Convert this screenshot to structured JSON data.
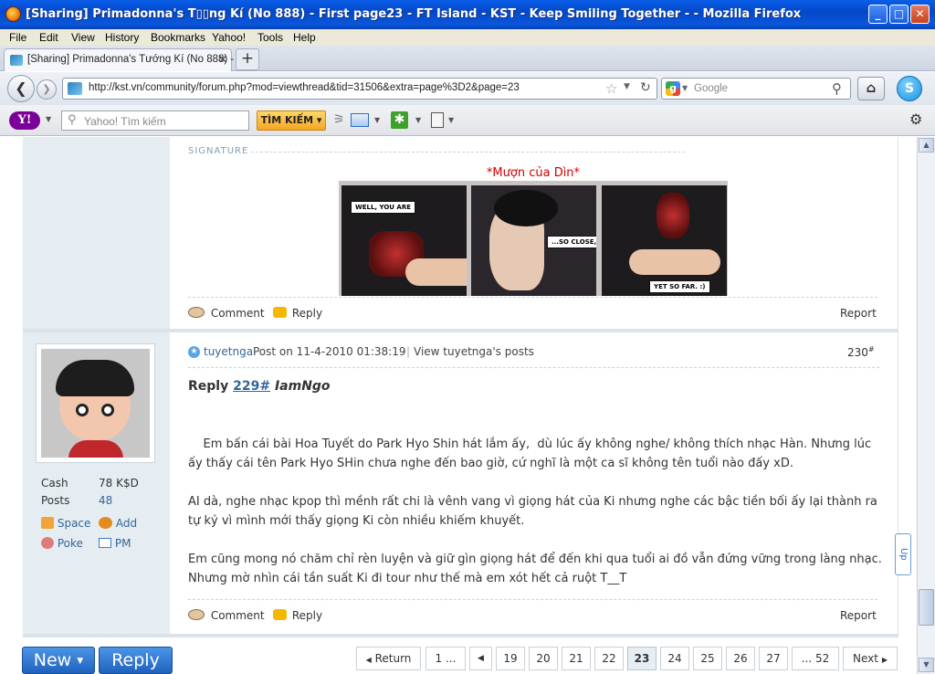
{
  "window": {
    "title": "[Sharing] Primadonna's T▯▯ng Kí (No 888) - First page23 - FT Island - KST - Keep Smiling Together - - Mozilla Firefox",
    "controls": {
      "minimize": "_",
      "maximize": "□",
      "close": "✕"
    }
  },
  "menu": [
    "File",
    "Edit",
    "View",
    "History",
    "Bookmarks",
    "Yahoo!",
    "Tools",
    "Help"
  ],
  "tab": {
    "label": "[Sharing] Primadonna's Tướng Kí (No 888) - ...",
    "close": "✕",
    "new_tab": "+"
  },
  "nav": {
    "url": "http://kst.vn/community/forum.php?mod=viewthread&tid=31506&extra=page%3D2&page=23",
    "search_placeholder": "Google",
    "search_engine_letter": "g"
  },
  "yahoo": {
    "logo": "Y!",
    "search_placeholder": "Yahoo! Tìm kiếm",
    "search_button": "TÌM KIẾM"
  },
  "post1": {
    "signature_label": "SIGNATURE",
    "signature_text": "*Mượn của Dìn*",
    "bubbles": [
      "WELL, YOU ARE",
      "...SO CLOSE,",
      "YET SO FAR. :)"
    ],
    "actions": {
      "comment": "Comment",
      "reply": "Reply",
      "report": "Report"
    }
  },
  "post2": {
    "user": {
      "name": "tuyetnga",
      "stats": [
        {
          "label": "Cash",
          "value": "78 K$D"
        },
        {
          "label": "Posts",
          "value": "48"
        }
      ],
      "links": {
        "space": "Space",
        "add": "Add",
        "poke": "Poke",
        "pm": "PM"
      }
    },
    "header": {
      "posted": "Post on 11-4-2010 01:38:19",
      "view_posts": "View tuyetnga's posts",
      "floor": "230",
      "floor_mark": "#"
    },
    "reply": {
      "prefix": "Reply",
      "ref": "229#",
      "to": "IamNgo"
    },
    "paragraphs": [
      "    Em bấn cái bài Hoa Tuyết do Park Hyo Shin hát lắm ấy,  dù lúc ấy không nghe/ không thích nhạc Hàn. Nhưng lúc ấy thấy cái tên Park Hyo SHin chưa nghe đến bao giờ, cứ nghĩ là một ca sĩ không tên tuổi nào đấy xD.",
      "AI dà, nghe nhạc kpop thì mềnh rất chi là vênh vang vì giọng hát của Ki nhưng nghe các bậc tiền bối ấy lại thành ra tự kỷ vì mình mới thấy giọng Ki còn nhiều khiếm khuyết.",
      "Em cũng mong nó chăm chỉ rèn luyện và giữ gìn giọng hát để đến khi qua tuổi ai đồ vẫn đứng vững trong làng nhạc. Nhưng mờ nhìn cái tần suất Ki đi tour như thế mà em xót hết cả ruột T__T"
    ],
    "actions": {
      "comment": "Comment",
      "reply": "Reply",
      "report": "Report"
    }
  },
  "side_widget": "Up",
  "bottom": {
    "new_button": "New",
    "reply_button": "Reply",
    "pagination": {
      "return": "Return",
      "first": "1 ...",
      "pages": [
        "19",
        "20",
        "21",
        "22",
        "23",
        "24",
        "25",
        "26",
        "27"
      ],
      "current": "23",
      "last": "... 52",
      "next": "Next"
    }
  },
  "colors": {
    "title_bar": "#0a57dd",
    "sidebar": "#e5edf2",
    "link": "#336699",
    "signature": "#cc0000",
    "button_blue": "#2f76c8"
  }
}
